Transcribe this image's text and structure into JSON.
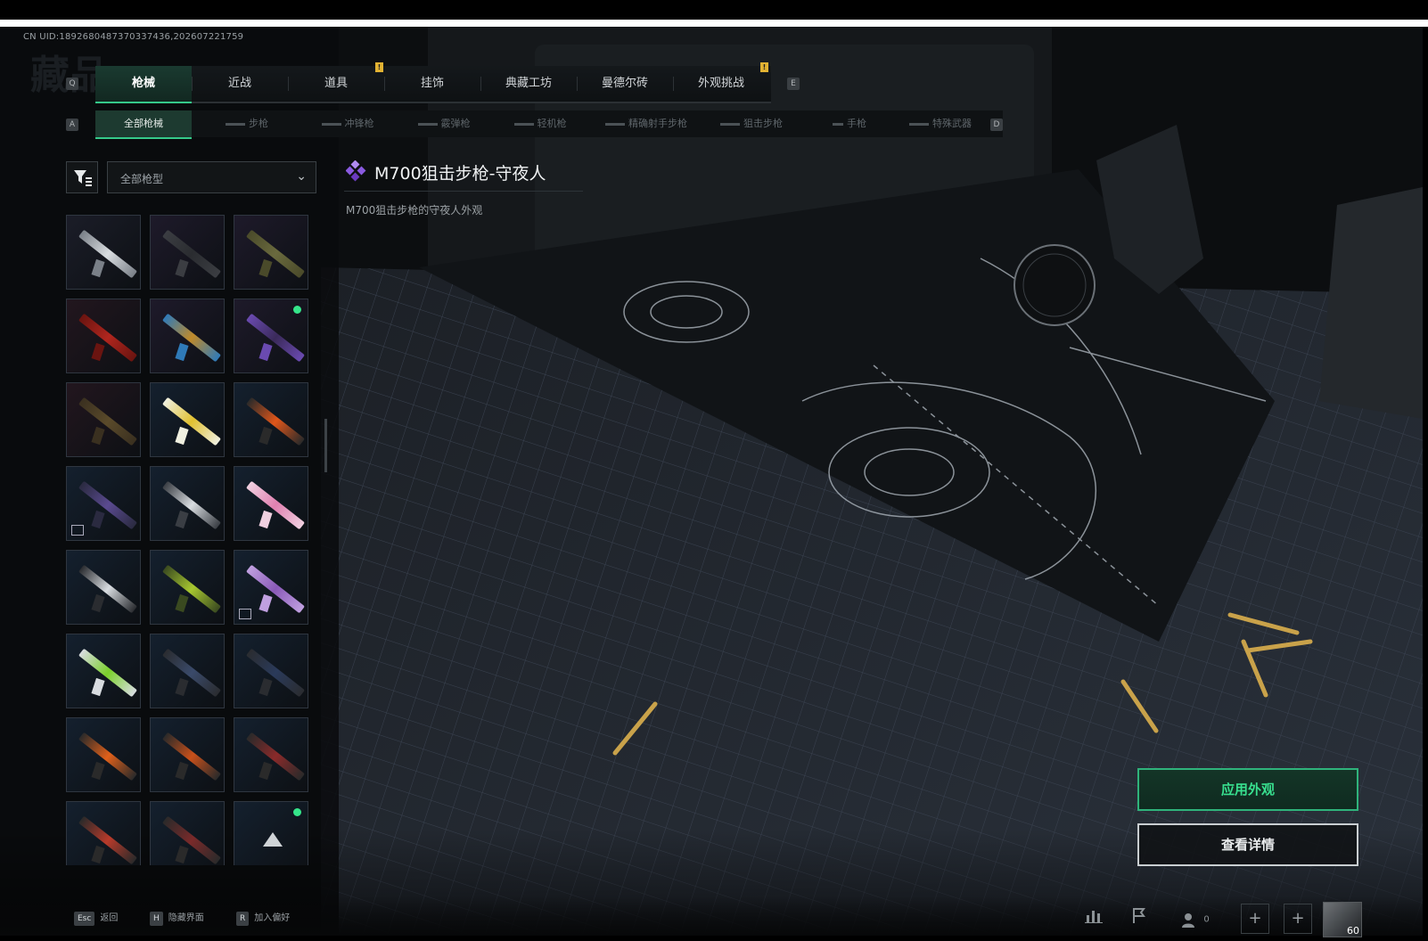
{
  "uid_text": "CN UID:1892680487370337436,202607221759",
  "bg_title": "藏品",
  "top_tabs": {
    "left_key": "Q",
    "right_key": "E",
    "items": [
      {
        "label": "枪械",
        "active": true
      },
      {
        "label": "近战",
        "active": false
      },
      {
        "label": "道具",
        "active": false
      },
      {
        "label": "挂饰",
        "active": false
      },
      {
        "label": "典藏工坊",
        "active": false
      },
      {
        "label": "曼德尔砖",
        "active": false
      },
      {
        "label": "外观挑战",
        "active": false
      }
    ],
    "badges": [
      "!",
      "!"
    ]
  },
  "sub_tabs": {
    "left_key": "A",
    "right_key": "D",
    "items": [
      {
        "label": "全部枪械",
        "active": true
      },
      {
        "label": "步枪",
        "active": false
      },
      {
        "label": "冲锋枪",
        "active": false
      },
      {
        "label": "霰弹枪",
        "active": false
      },
      {
        "label": "轻机枪",
        "active": false
      },
      {
        "label": "精确射手步枪",
        "active": false
      },
      {
        "label": "狙击步枪",
        "active": false
      },
      {
        "label": "手枪",
        "active": false
      },
      {
        "label": "特殊武器",
        "active": false
      }
    ]
  },
  "filter": {
    "icon": "filter-icon",
    "dropdown_value": "全部枪型",
    "dropdown_icon": "chevron-down-icon"
  },
  "weapon_grid": [
    {
      "color": "#d9dde0",
      "accent": "#7a8088",
      "bg": "#1b1d28",
      "dot": false,
      "small_icon": false
    },
    {
      "color": "#2a2c30",
      "accent": "#3b3d42",
      "bg": "#1e1a2a",
      "dot": false,
      "small_icon": false
    },
    {
      "color": "#6a6a3e",
      "accent": "#4a4a2a",
      "bg": "#1e1a2a",
      "dot": false,
      "small_icon": false
    },
    {
      "color": "#b0261e",
      "accent": "#6a1410",
      "bg": "#22161e",
      "dot": false,
      "small_icon": false
    },
    {
      "color": "#c08a2a",
      "accent": "#2f7ab8",
      "bg": "#1e1a2a",
      "dot": false,
      "small_icon": false
    },
    {
      "color": "#3a2a5a",
      "accent": "#6a4ab0",
      "bg": "#1e1a2a",
      "dot": true,
      "small_icon": false
    },
    {
      "color": "#5a4a2a",
      "accent": "#3a3020",
      "bg": "#22161e",
      "dot": false,
      "small_icon": false
    },
    {
      "color": "#e0c030",
      "accent": "#f0f0e0",
      "bg": "#14202e",
      "dot": false,
      "small_icon": false
    },
    {
      "color": "#e0561a",
      "accent": "#2a2a2a",
      "bg": "#14202e",
      "dot": false,
      "small_icon": false
    },
    {
      "color": "#5a4a90",
      "accent": "#2a2a40",
      "bg": "#14202e",
      "dot": false,
      "small_icon": true
    },
    {
      "color": "#d8dce0",
      "accent": "#3a3e44",
      "bg": "#14202e",
      "dot": false,
      "small_icon": false
    },
    {
      "color": "#e080b0",
      "accent": "#f0d0e0",
      "bg": "#14202e",
      "dot": false,
      "small_icon": false
    },
    {
      "color": "#d8dce0",
      "accent": "#2a2c30",
      "bg": "#14202e",
      "dot": false,
      "small_icon": false
    },
    {
      "color": "#a8c830",
      "accent": "#3a4a20",
      "bg": "#14202e",
      "dot": false,
      "small_icon": false
    },
    {
      "color": "#8a5ab8",
      "accent": "#c0a0e0",
      "bg": "#14202e",
      "dot": false,
      "small_icon": true
    },
    {
      "color": "#7ad02a",
      "accent": "#d8dce0",
      "bg": "#14202e",
      "dot": false,
      "small_icon": false
    },
    {
      "color": "#3a4a6a",
      "accent": "#2a2c30",
      "bg": "#14202e",
      "dot": false,
      "small_icon": false
    },
    {
      "color": "#2a3a5a",
      "accent": "#2a2c30",
      "bg": "#14202e",
      "dot": false,
      "small_icon": false
    },
    {
      "color": "#e0601a",
      "accent": "#2a2a2a",
      "bg": "#14202e",
      "dot": false,
      "small_icon": false
    },
    {
      "color": "#c8501a",
      "accent": "#2a2a2a",
      "bg": "#14202e",
      "dot": false,
      "small_icon": false
    },
    {
      "color": "#8a2a2a",
      "accent": "#2a2a2a",
      "bg": "#14202e",
      "dot": false,
      "small_icon": false
    },
    {
      "color": "#b83a2a",
      "accent": "#2a2a2a",
      "bg": "#14202e",
      "dot": false,
      "small_icon": false
    },
    {
      "color": "#7a2a2a",
      "accent": "#2a2a2a",
      "bg": "#14202e",
      "dot": false,
      "small_icon": false
    },
    {
      "color": "",
      "accent": "",
      "bg": "#14202e",
      "dot": true,
      "small_icon": false,
      "placeholder_icon": "triangle-logo-icon"
    }
  ],
  "detail": {
    "rarity_icon": "purple-diamond-icon",
    "title": "M700狙击步枪-守夜人",
    "description": "M700狙击步枪的守夜人外观",
    "rarity_color": "#8a5ae0"
  },
  "buttons": {
    "apply": "应用外观",
    "details": "查看详情"
  },
  "bottom_hints": [
    {
      "key": "Esc",
      "label": "返回"
    },
    {
      "key": "H",
      "label": "隐藏界面"
    },
    {
      "key": "R",
      "label": "加入偏好"
    }
  ],
  "status": {
    "friends_count": "0",
    "level": "60"
  },
  "colors": {
    "accent_green": "#35c98a",
    "badge_yellow": "#e2b232"
  }
}
